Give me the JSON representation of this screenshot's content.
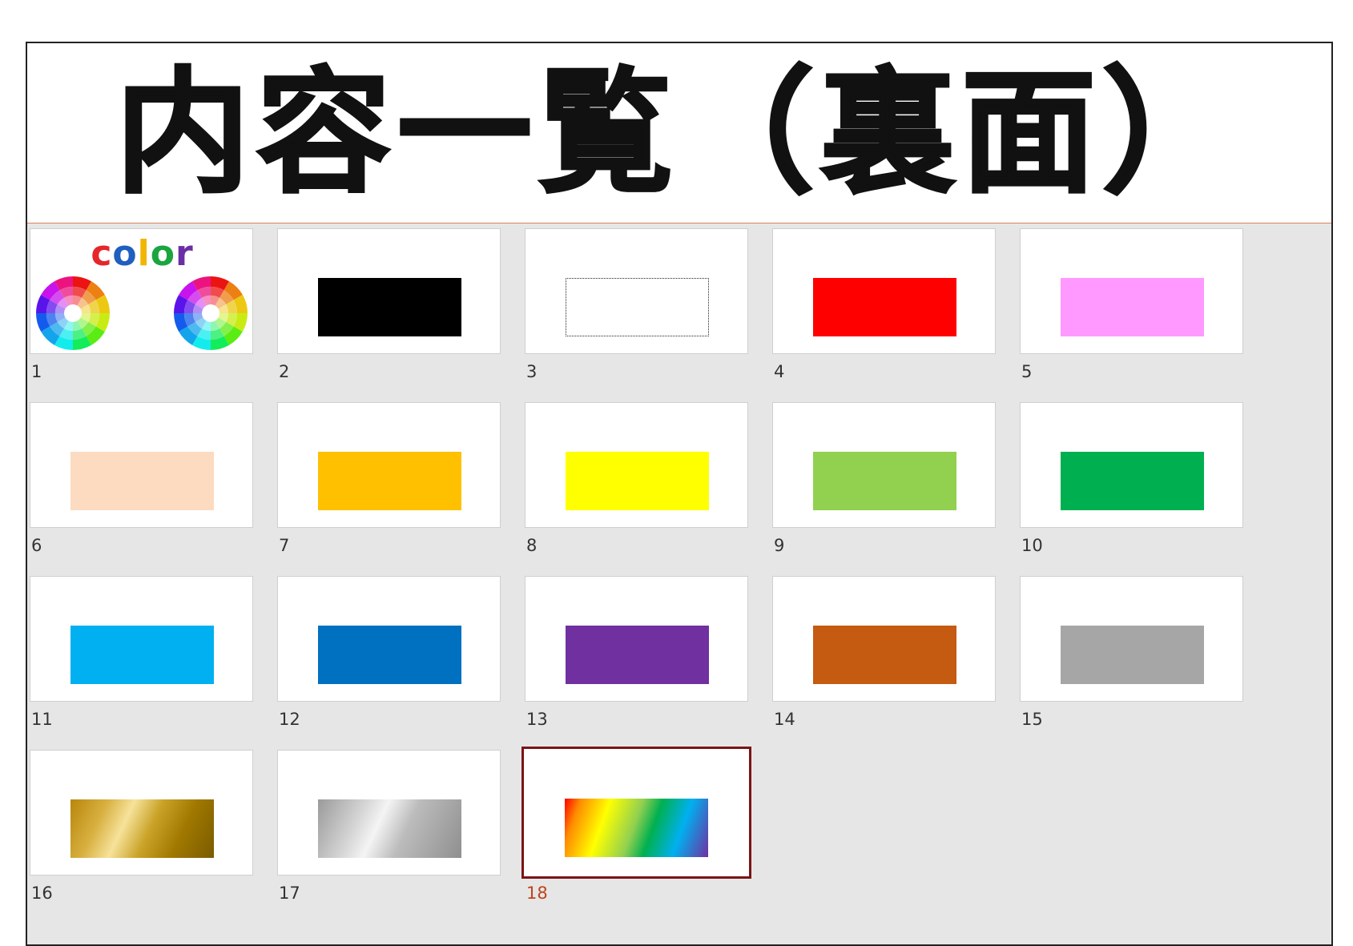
{
  "page": {
    "title": "内容一覧（裏面）"
  },
  "cover": {
    "letters": [
      {
        "ch": "c",
        "color": "#e5262a"
      },
      {
        "ch": "o",
        "color": "#1f5fbf"
      },
      {
        "ch": "l",
        "color": "#f2b500"
      },
      {
        "ch": "o",
        "color": "#1aa53f"
      },
      {
        "ch": "r",
        "color": "#6b2fa5"
      }
    ]
  },
  "slides": [
    {
      "number": "1",
      "kind": "cover"
    },
    {
      "number": "2",
      "kind": "solid",
      "color": "#000000"
    },
    {
      "number": "3",
      "kind": "dotted"
    },
    {
      "number": "4",
      "kind": "solid",
      "color": "#ff0000"
    },
    {
      "number": "5",
      "kind": "solid",
      "color": "#ff99ff"
    },
    {
      "number": "6",
      "kind": "solid",
      "color": "#fddbc0"
    },
    {
      "number": "7",
      "kind": "solid",
      "color": "#ffc000"
    },
    {
      "number": "8",
      "kind": "solid",
      "color": "#ffff00"
    },
    {
      "number": "9",
      "kind": "solid",
      "color": "#92d050"
    },
    {
      "number": "10",
      "kind": "solid",
      "color": "#00b050"
    },
    {
      "number": "11",
      "kind": "solid",
      "color": "#00b0f0"
    },
    {
      "number": "12",
      "kind": "solid",
      "color": "#0070c0"
    },
    {
      "number": "13",
      "kind": "solid",
      "color": "#7030a0"
    },
    {
      "number": "14",
      "kind": "solid",
      "color": "#c55a11"
    },
    {
      "number": "15",
      "kind": "solid",
      "color": "#a6a6a6"
    },
    {
      "number": "16",
      "kind": "gradient",
      "name": "gold"
    },
    {
      "number": "17",
      "kind": "gradient",
      "name": "silver"
    },
    {
      "number": "18",
      "kind": "gradient",
      "name": "rainbow",
      "selected": true
    }
  ]
}
